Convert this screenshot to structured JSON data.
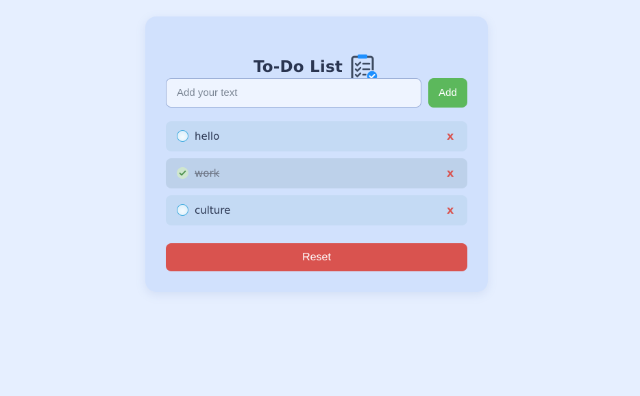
{
  "header": {
    "title": "To-Do List",
    "icon": "clipboard-checklist-icon"
  },
  "input": {
    "placeholder": "Add your text",
    "value": ""
  },
  "add_button": {
    "label": "Add"
  },
  "tasks": [
    {
      "label": "hello",
      "completed": false,
      "delete_label": "x"
    },
    {
      "label": "work",
      "completed": true,
      "delete_label": "x"
    },
    {
      "label": "culture",
      "completed": false,
      "delete_label": "x"
    }
  ],
  "reset_button": {
    "label": "Reset"
  },
  "colors": {
    "page_background": "#e6efff",
    "card_background": "#d1e1fd",
    "add_green": "#5cb85c",
    "reset_red": "#d9534f",
    "delete_red": "#d9534f",
    "checkbox_blue": "#47aee0",
    "title_text": "#2a3550"
  }
}
